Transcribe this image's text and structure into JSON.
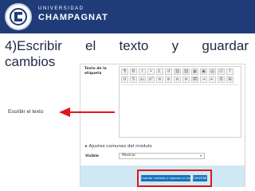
{
  "header": {
    "university_label": "UNIVERSIDAD",
    "university_name": "CHAMPAGNAT"
  },
  "slide_title": {
    "line1": [
      "4)Escribir",
      "el",
      "texto",
      "y",
      "guardar"
    ],
    "line2": "cambios"
  },
  "annotation": {
    "label": "Escribir el texto"
  },
  "form": {
    "field_label": "Texto de la etiqueta",
    "toolbar_row1": [
      "¶",
      "B",
      "I",
      "•",
      "1.",
      "↺",
      "⛓",
      "⛓",
      "▦",
      "▣",
      "▤",
      "☑",
      "?"
    ],
    "toolbar_row2": [
      "U",
      "S",
      "x₂",
      "x²",
      "≡",
      "≡",
      "≡",
      "≡",
      "⌧",
      "⇥",
      "⇤",
      "Ω",
      "⊞"
    ],
    "section_heading": "Ajustes comunes del módulo",
    "visible_label": "Visible",
    "visible_value": "Mostrar",
    "save_button": "Guardar cambios y regresar al curso",
    "cancel_button": "Cancelar"
  },
  "colors": {
    "header_bg": "#1f3c78",
    "highlight": "#e3141b",
    "arrow": "#e3141b",
    "button": "#1a73b8",
    "footer_bg": "#cfe8f3"
  }
}
